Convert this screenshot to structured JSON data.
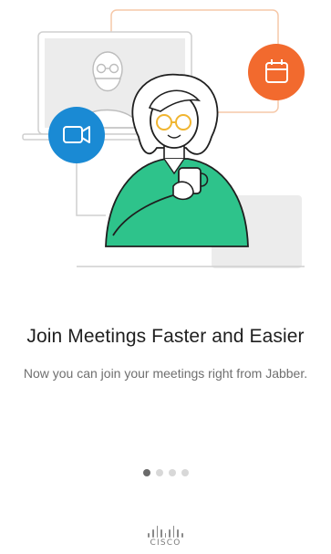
{
  "onboarding": {
    "title": "Join Meetings Faster and Easier",
    "description": "Now you can join your meetings right from Jabber.",
    "pages_total": 4,
    "current_page": 1
  },
  "brand": {
    "wordmark": "CISCO"
  },
  "illustration": {
    "subject": "woman holding a coffee cup in front of a video call window",
    "icons": [
      "video-camera-icon",
      "calendar-icon"
    ]
  },
  "colors": {
    "accent_green": "#2ec38b",
    "accent_blue": "#1a8ad4",
    "accent_orange": "#f26a2e",
    "line_gray": "#d6d6d6",
    "panel_gray": "#ececec"
  }
}
